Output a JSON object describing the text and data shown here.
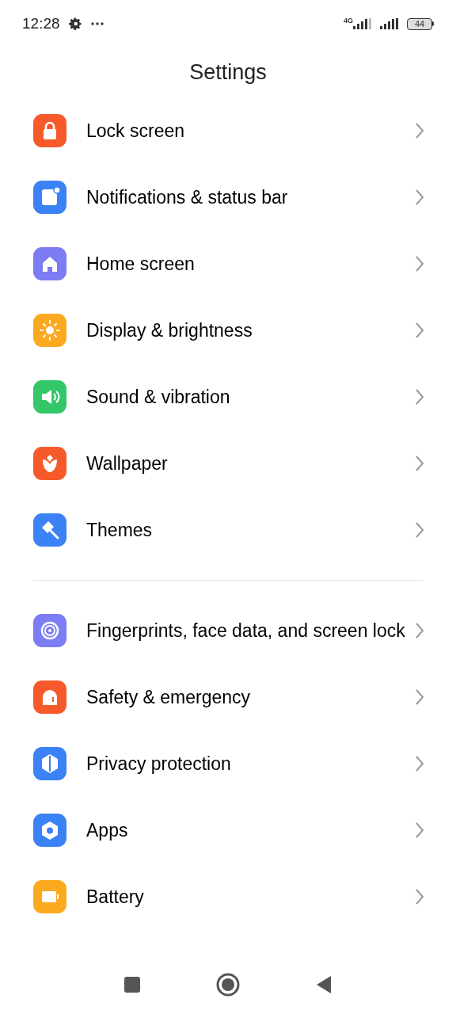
{
  "status_bar": {
    "time": "12:28",
    "network": "4G",
    "battery": "44"
  },
  "title": "Settings",
  "groups": [
    [
      {
        "label": "Lock screen",
        "color": "#f65a2b"
      },
      {
        "label": "Notifications & status bar",
        "color": "#3b82f6"
      },
      {
        "label": "Home screen",
        "color": "#7c7cf4"
      },
      {
        "label": "Display & brightness",
        "color": "#fbaa1f"
      },
      {
        "label": "Sound & vibration",
        "color": "#33c767"
      },
      {
        "label": "Wallpaper",
        "color": "#f65a2b"
      },
      {
        "label": "Themes",
        "color": "#3b82f6"
      }
    ],
    [
      {
        "label": "Fingerprints, face data, and screen lock",
        "color": "#7c7cf4"
      },
      {
        "label": "Safety & emergency",
        "color": "#f65a2b"
      },
      {
        "label": "Privacy protection",
        "color": "#3b82f6"
      },
      {
        "label": "Apps",
        "color": "#3b82f6"
      },
      {
        "label": "Battery",
        "color": "#fbaa1f"
      }
    ]
  ]
}
